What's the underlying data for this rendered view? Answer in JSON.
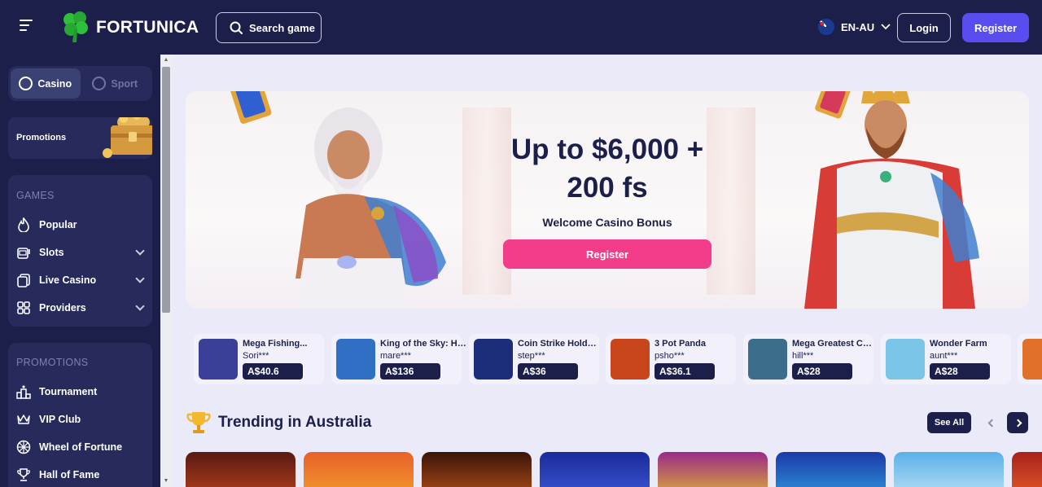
{
  "header": {
    "brand": "FORTUNICA",
    "search_label": "Search game",
    "lang_label": "EN-AU",
    "login_label": "Login",
    "register_label": "Register"
  },
  "sidebar": {
    "tabs": [
      {
        "label": "Casino",
        "active": true
      },
      {
        "label": "Sport",
        "active": false
      }
    ],
    "promo_card_label": "Promotions",
    "games_title": "GAMES",
    "games": [
      {
        "label": "Popular",
        "icon": "flame-icon"
      },
      {
        "label": "Slots",
        "icon": "slot-machine-icon"
      },
      {
        "label": "Live Casino",
        "icon": "cards-icon"
      },
      {
        "label": "Providers",
        "icon": "grid-icon"
      }
    ],
    "promotions_title": "PROMOTIONS",
    "promotions": [
      {
        "label": "Tournament",
        "icon": "podium-icon"
      },
      {
        "label": "VIP Club",
        "icon": "crown-icon"
      },
      {
        "label": "Wheel of Fortune",
        "icon": "wheel-icon"
      },
      {
        "label": "Hall of Fame",
        "icon": "trophy-icon"
      }
    ]
  },
  "hero": {
    "title_line1": "Up to $6,000 +",
    "title_line2": "200 fs",
    "subtitle": "Welcome Casino Bonus",
    "button_label": "Register"
  },
  "recent_wins": [
    {
      "game": "Mega Fishing...",
      "user": "Sori***",
      "amount": "A$40.6",
      "color": "#3b3f9a"
    },
    {
      "game": "King of the Sky: Hit...",
      "user": "mare***",
      "amount": "A$136",
      "color": "#2f6fc4"
    },
    {
      "game": "Coin Strike Hold a...",
      "user": "step***",
      "amount": "A$36",
      "color": "#1c2e7a"
    },
    {
      "game": "3 Pot Panda",
      "user": "psho***",
      "amount": "A$36.1",
      "color": "#c9451c"
    },
    {
      "game": "Mega Greatest Catc...",
      "user": "hill***",
      "amount": "A$28",
      "color": "#3a6e8a"
    },
    {
      "game": "Wonder Farm",
      "user": "aunt***",
      "amount": "A$28",
      "color": "#7bc6e8"
    }
  ],
  "trending": {
    "title": "Trending in Australia",
    "see_all_label": "See All"
  },
  "colors": {
    "navy": "#1b1f4a",
    "accent": "#5a4df0",
    "pink": "#f33c8a"
  }
}
